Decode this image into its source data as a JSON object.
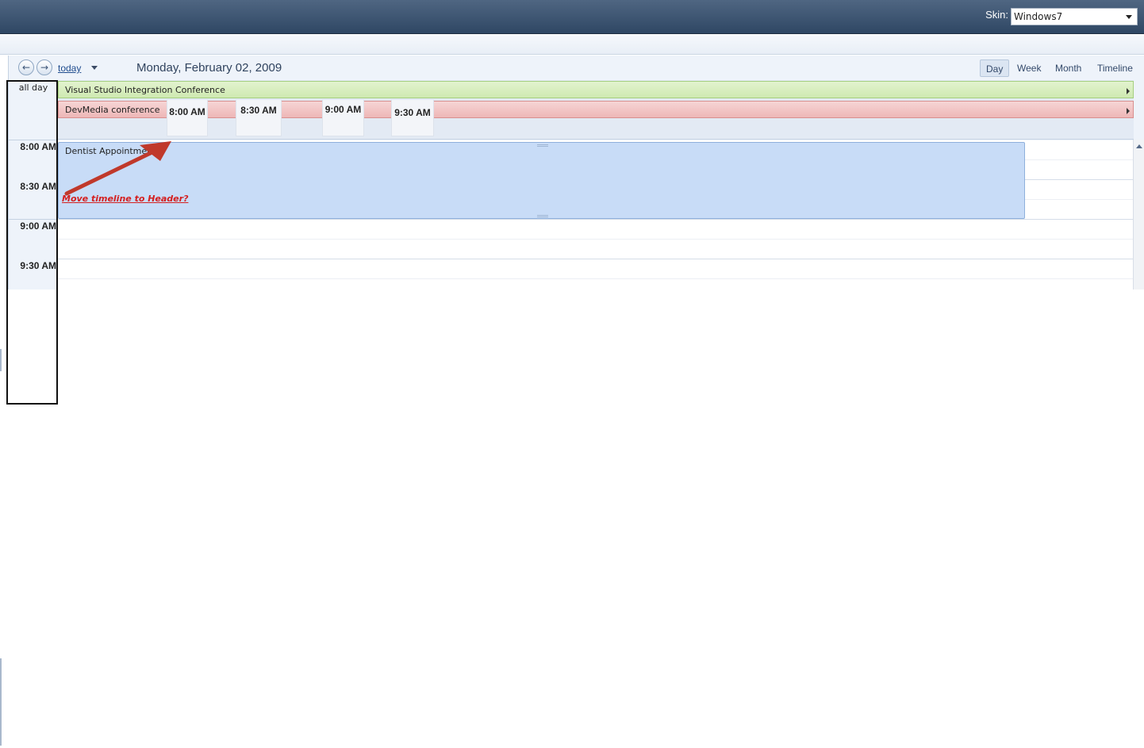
{
  "topbar": {
    "skin_label": "Skin:",
    "skin_value": "Windows7"
  },
  "toolbar": {
    "prev_icon": "arrow-left-icon",
    "next_icon": "arrow-right-icon",
    "today_label": "today",
    "date_title": "Monday, February 02, 2009",
    "views": [
      "Day",
      "Week",
      "Month",
      "Timeline"
    ],
    "active_view": "Day"
  },
  "time_column": {
    "allday_label": "all day",
    "slots": [
      "8:00 AM",
      "8:30 AM",
      "9:00 AM",
      "9:30 AM"
    ]
  },
  "allday_events": [
    {
      "title": "Visual Studio Integration Conference",
      "color": "#d7eebf"
    },
    {
      "title": "DevMedia conference",
      "color": "#f2c6c6"
    }
  ],
  "header_timeline": [
    "8:00 AM",
    "8:30 AM",
    "9:00 AM",
    "9:30 AM"
  ],
  "appointments": [
    {
      "title": "Dentist Appointment",
      "color": "#c8dcf7"
    }
  ],
  "annotation": {
    "text": "Move timeline to Header?",
    "color": "#d42020"
  }
}
